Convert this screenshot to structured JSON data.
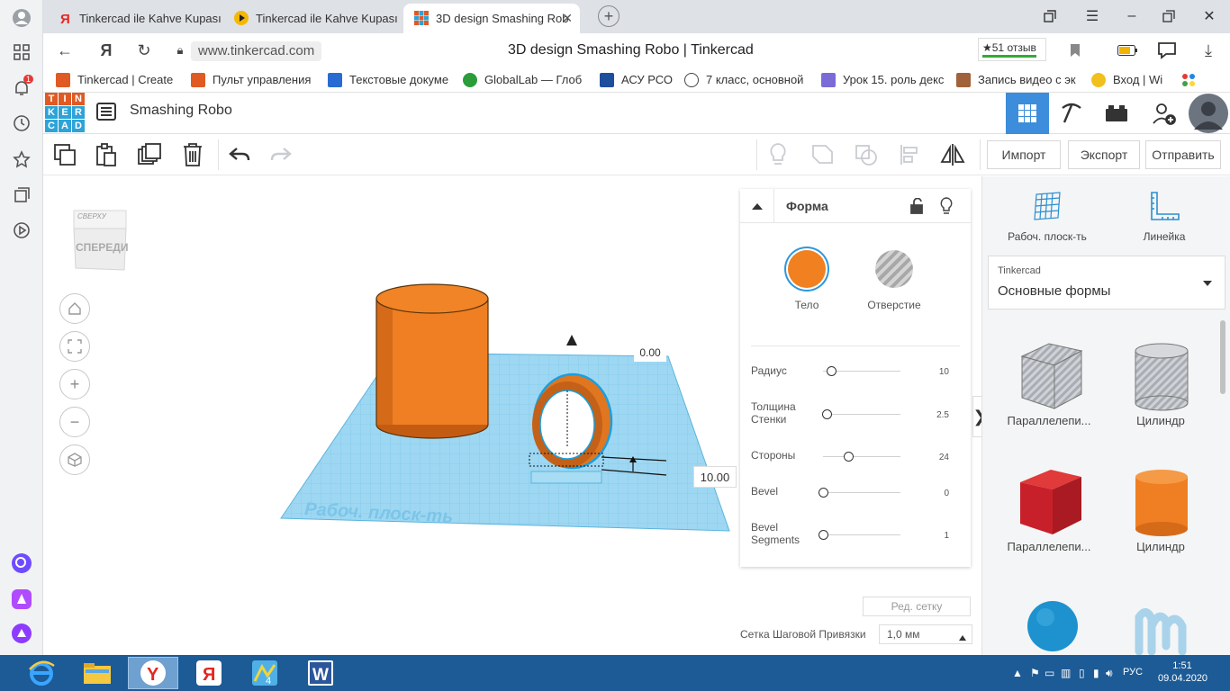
{
  "browser": {
    "tabs": [
      {
        "label": "Tinkercad ile Kahve Kupası",
        "favicon_color": "#e52620"
      },
      {
        "label": "Tinkercad ile Kahve Kupası",
        "favicon_color": "#f5b800"
      },
      {
        "label": "3D design Smashing Rob",
        "favicon_color": "#e05a24"
      }
    ],
    "url_host": "www.tinkercad.com",
    "page_title": "3D design Smashing Robo | Tinkercad",
    "reviews": "★51 отзыв",
    "yandex_letter": "Я",
    "notification_count": "1",
    "bookmarks": [
      {
        "label": "Tinkercad | Create",
        "color": "#e05a24"
      },
      {
        "label": "Пульт управления",
        "color": "#e05a24"
      },
      {
        "label": "Текстовые докуме",
        "color": "#2a6bd1"
      },
      {
        "label": "GlobalLab — Глоб",
        "color": "#2a9d3a"
      },
      {
        "label": "АСУ РСО",
        "color": "#1d4f9c"
      },
      {
        "label": "7 класс, основной",
        "color": "#444444"
      },
      {
        "label": "Урок 15. роль декс",
        "color": "#7b6bd6"
      },
      {
        "label": "Запись видео с эк",
        "color": "#a0623a"
      },
      {
        "label": "Вход | Wi",
        "color": "#f2c01c"
      }
    ]
  },
  "app": {
    "logo_letters": [
      "T",
      "I",
      "N",
      "K",
      "E",
      "R",
      "C",
      "A",
      "D"
    ],
    "design_name": "Smashing Robo",
    "toolbar": {
      "import": "Импорт",
      "export": "Экспорт",
      "send": "Отправить"
    }
  },
  "viewport": {
    "view_cube_top": "СВЕРХУ",
    "view_cube_front": "СПЕРЕДИ",
    "workplane_label": "Рабоч. плоск-ть",
    "dim_top": "0.00",
    "dim_side": "10.00"
  },
  "shape_panel": {
    "title": "Форма",
    "solid_label": "Тело",
    "hole_label": "Отверстие",
    "solid_color": "#f08020",
    "properties": [
      {
        "label": "Радиус",
        "value": "10",
        "fraction": 0.1
      },
      {
        "label": "Толщина Стенки",
        "value": "2.5",
        "fraction": 0.05
      },
      {
        "label": "Стороны",
        "value": "24",
        "fraction": 0.32
      },
      {
        "label": "Bevel",
        "value": "0",
        "fraction": 0.0
      },
      {
        "label": "Bevel Segments",
        "value": "1",
        "fraction": 0.0
      }
    ],
    "edit_grid": "Ред. сетку",
    "snap_label": "Сетка Шаговой Привязки",
    "snap_value": "1,0 мм"
  },
  "library": {
    "workplane": "Рабоч. плоск-ть",
    "ruler": "Линейка",
    "source": "Tinkercad",
    "category": "Основные формы",
    "shapes": [
      {
        "label": "Параллелепи...",
        "kind": "box-hole"
      },
      {
        "label": "Цилиндр",
        "kind": "cylinder-hole"
      },
      {
        "label": "Параллелепи...",
        "kind": "box-red"
      },
      {
        "label": "Цилиндр",
        "kind": "cylinder-orange"
      },
      {
        "label": "",
        "kind": "sphere"
      },
      {
        "label": "",
        "kind": "scribble"
      }
    ]
  },
  "taskbar": {
    "lang": "РУС",
    "time": "1:51",
    "date": "09.04.2020"
  }
}
